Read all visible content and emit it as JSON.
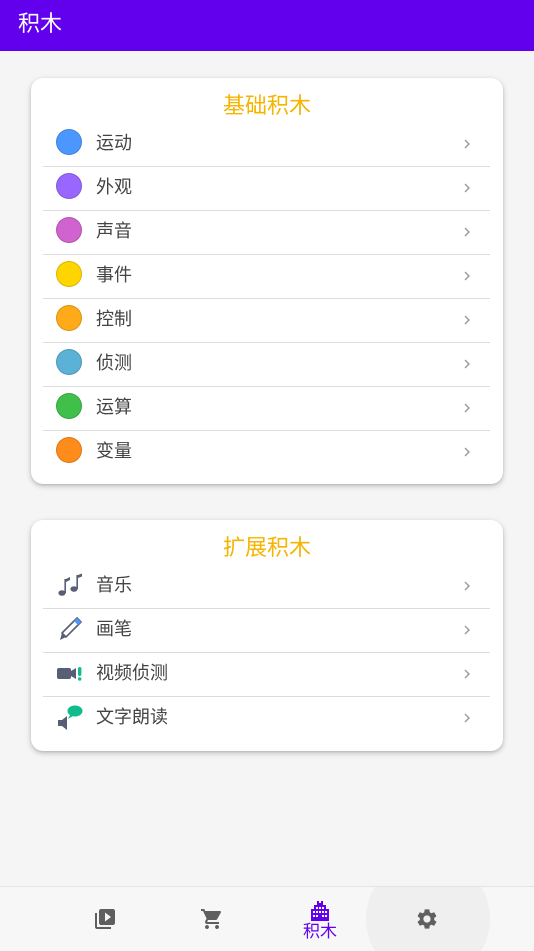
{
  "appbar": {
    "title": "积木",
    "color": "#6200ee"
  },
  "basic": {
    "title": "基础积木",
    "items": [
      {
        "label": "运动",
        "color": "#4c97ff"
      },
      {
        "label": "外观",
        "color": "#9966ff"
      },
      {
        "label": "声音",
        "color": "#cf63cf"
      },
      {
        "label": "事件",
        "color": "#ffd500"
      },
      {
        "label": "控制",
        "color": "#ffab19"
      },
      {
        "label": "侦测",
        "color": "#5cb1d6"
      },
      {
        "label": "运算",
        "color": "#40bf4a"
      },
      {
        "label": "变量",
        "color": "#ff8c1a"
      }
    ]
  },
  "extension": {
    "title": "扩展积木",
    "items": [
      {
        "label": "音乐",
        "icon": "music-notes-icon"
      },
      {
        "label": "画笔",
        "icon": "pen-icon"
      },
      {
        "label": "视频侦测",
        "icon": "video-sensing-icon"
      },
      {
        "label": "文字朗读",
        "icon": "text-to-speech-icon"
      }
    ]
  },
  "bottom_nav": {
    "items": [
      {
        "icon": "video-library-icon",
        "label": ""
      },
      {
        "icon": "shopping-cart-icon",
        "label": ""
      },
      {
        "icon": "blocks-icon",
        "label": "积木",
        "active": true
      },
      {
        "icon": "settings-icon",
        "label": ""
      }
    ]
  }
}
